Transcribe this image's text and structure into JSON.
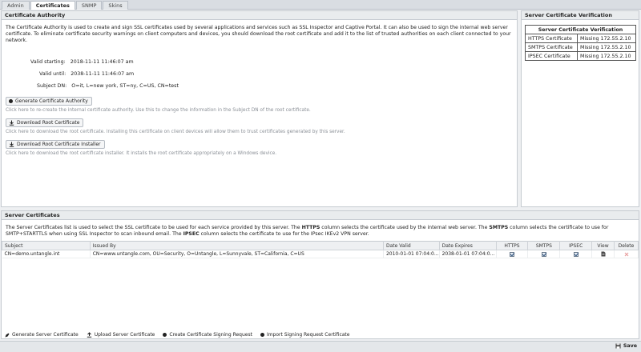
{
  "tabs": [
    "Admin",
    "Certificates",
    "SNMP",
    "Skins"
  ],
  "ca": {
    "title": "Certificate Authority",
    "intro": "The Certificate Authority is used to create and sign SSL certificates used by several applications and services such as SSL Inspector and Captive Portal. It can also be used to sign the internal web server certificate. To eliminate certificate security warnings on client computers and devices, you should download the root certificate and add it to the list of trusted authorities on each client connected to your network.",
    "valid_starting_label": "Valid starting:",
    "valid_starting": "2018-11-11 11:46:07 am",
    "valid_until_label": "Valid until:",
    "valid_until": "2038-11-11 11:46:07 am",
    "subject_label": "Subject DN:",
    "subject": "O=it, L=new york, ST=ny, C=US, CN=test",
    "generate_label": "Generate Certificate Authority",
    "generate_hint": "Click here to re-create the internal certificate authority. Use this to change the information in the Subject DN of the root certificate.",
    "download_root_label": "Download Root Certificate",
    "download_root_hint": "Click here to download the root certificate. Installing this certificate on client devices will allow them to trust certificates generated by this server.",
    "download_installer_label": "Download Root Certificate Installer",
    "download_installer_hint": "Click here to download the root certificate installer. It installs the root certificate appropriately on a Windows device."
  },
  "verification": {
    "title": "Server Certificate Verification",
    "table_title": "Server Certificate Verification",
    "rows": [
      {
        "name": "HTTPS Certificate",
        "status": "Missing 172.55.2.10"
      },
      {
        "name": "SMTPS Certificate",
        "status": "Missing 172.55.2.10"
      },
      {
        "name": "IPSEC Certificate",
        "status": "Missing 172.55.2.10"
      }
    ]
  },
  "certs": {
    "title": "Server Certificates",
    "intro_1": "The Server Certificates list is used to select the SSL certificate to be used for each service provided by this server. The ",
    "intro_https": "HTTPS",
    "intro_2": " column selects the certificate used by the internal web server. The ",
    "intro_smtps": "SMTPS",
    "intro_3": " column selects the certificate to use for SMTP+STARTTLS when using SSL Inspector to scan inbound email. The ",
    "intro_ipsec": "IPSEC",
    "intro_4": " column selects the certificate to use for the IPsec IKEv2 VPN server.",
    "columns": {
      "subject": "Subject",
      "issued_by": "Issued By",
      "date_valid": "Date Valid",
      "date_expires": "Date Expires",
      "https": "HTTPS",
      "smtps": "SMTPS",
      "ipsec": "IPSEC",
      "view": "View",
      "delete": "Delete"
    },
    "row": {
      "subject": "CN=demo.untangle.int",
      "issued_by": "CN=www.untangle.com, OU=Security, O=Untangle, L=Sunnyvale, ST=California, C=US",
      "date_valid": "2010-01-01 07:04:0...",
      "date_expires": "2038-01-01 07:04:0...",
      "https": true,
      "smtps": true,
      "ipsec": true
    },
    "toolbar": {
      "generate": "Generate Server Certificate",
      "upload": "Upload Server Certificate",
      "csr": "Create Certificate Signing Request",
      "import": "Import Signing Request Certificate"
    }
  },
  "footer": {
    "save": "Save"
  },
  "colors": {
    "accent": "#2a4f7a",
    "delete": "#d9534f"
  }
}
